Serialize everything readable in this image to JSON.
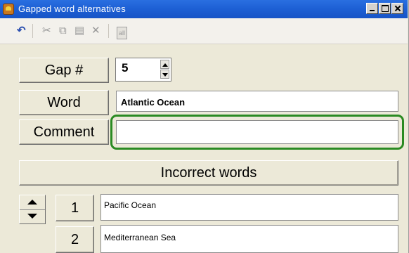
{
  "window": {
    "title": "Gapped word alternatives",
    "controls": [
      "minimize",
      "maximize",
      "close"
    ]
  },
  "toolbar": {
    "undo_icon": "undo-icon",
    "cut_icon": "scissors-icon",
    "copy_icon": "copy-icon",
    "paste_icon": "paste-icon",
    "delete_icon": "x-icon",
    "select_all_label": "all"
  },
  "form": {
    "gap_label": "Gap #",
    "gap_value": "5",
    "word_label": "Word",
    "word_value": "Atlantic Ocean",
    "comment_label": "Comment",
    "comment_value": ""
  },
  "incorrect": {
    "header": "Incorrect words",
    "rows": [
      {
        "num": "1",
        "value": "Pacific Ocean"
      },
      {
        "num": "2",
        "value": "Mediterranean Sea"
      }
    ]
  },
  "colors": {
    "titlebar": "#1d5fd4",
    "highlight": "#2a8a22",
    "panel": "#ece9d8"
  }
}
